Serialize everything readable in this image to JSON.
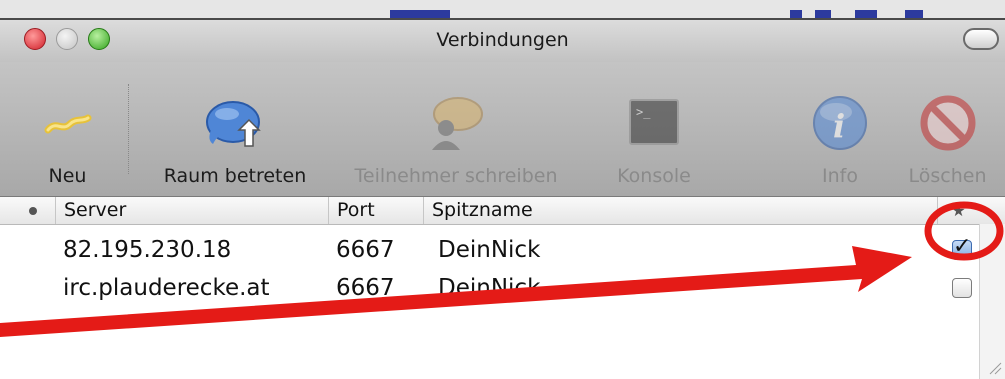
{
  "window": {
    "title": "Verbindungen"
  },
  "toolbar": {
    "items": [
      {
        "label": "Neu",
        "icon": "new-connection-icon",
        "enabled": true
      },
      {
        "label": "Raum betreten",
        "icon": "enter-room-icon",
        "enabled": true
      },
      {
        "label": "Teilnehmer schreiben",
        "icon": "message-user-icon",
        "enabled": false
      },
      {
        "label": "Konsole",
        "icon": "console-icon",
        "enabled": false
      },
      {
        "label": "Info",
        "icon": "info-icon",
        "enabled": false
      },
      {
        "label": "Löschen",
        "icon": "delete-icon",
        "enabled": false
      }
    ]
  },
  "table": {
    "columns": {
      "status": "",
      "server": "Server",
      "port": "Port",
      "nick": "Spitzname",
      "favorite": "★"
    },
    "rows": [
      {
        "server": "82.195.230.18",
        "port": "6667",
        "nick": "DeinNick",
        "favorite": true
      },
      {
        "server": "irc.plauderecke.at",
        "port": "6667",
        "nick": "DeinNick",
        "favorite": false
      }
    ]
  },
  "colors": {
    "annotation": "#e41b17",
    "close_button": "#d0202a",
    "zoom_button": "#34a41e"
  }
}
